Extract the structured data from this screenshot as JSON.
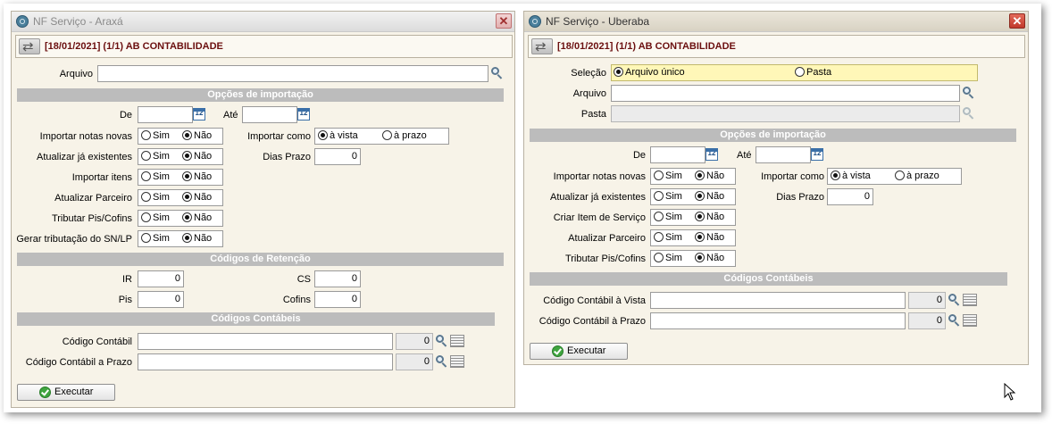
{
  "window_left": {
    "title": "NF Serviço - Araxá",
    "header": "[18/01/2021] (1/1) AB CONTABILIDADE",
    "arquivo_label": "Arquivo",
    "arquivo_value": "",
    "section_import": "Opções de importação",
    "de_label": "De",
    "ate_label": "Até",
    "cal_text": "12",
    "rows": [
      {
        "label": "Importar notas novas",
        "sim": "Sim",
        "nao": "Não",
        "selected": "nao"
      },
      {
        "label": "Atualizar já existentes",
        "sim": "Sim",
        "nao": "Não",
        "selected": "nao"
      },
      {
        "label": "Importar itens",
        "sim": "Sim",
        "nao": "Não",
        "selected": "nao"
      },
      {
        "label": "Atualizar Parceiro",
        "sim": "Sim",
        "nao": "Não",
        "selected": "nao"
      },
      {
        "label": "Tributar Pis/Cofins",
        "sim": "Sim",
        "nao": "Não",
        "selected": "nao"
      },
      {
        "label": "Gerar tributação do SN/LP",
        "sim": "Sim",
        "nao": "Não",
        "selected": "nao"
      }
    ],
    "importar_como_label": "Importar como",
    "a_vista": "à vista",
    "a_prazo": "à prazo",
    "dias_prazo_label": "Dias Prazo",
    "dias_prazo_value": "0",
    "section_retencao": "Códigos de Retenção",
    "ir_label": "IR",
    "ir_value": "0",
    "cs_label": "CS",
    "cs_value": "0",
    "pis_label": "Pis",
    "pis_value": "0",
    "cofins_label": "Cofins",
    "cofins_value": "0",
    "section_contabeis": "Códigos Contábeis",
    "codigo_contabil_label": "Código Contábil",
    "codigo_contabil_num": "0",
    "codigo_contabil_prazo_label": "Código Contábil a Prazo",
    "codigo_contabil_prazo_num": "0",
    "executar": "Executar"
  },
  "window_right": {
    "title": "NF Serviço - Uberaba",
    "header": "[18/01/2021] (1/1) AB CONTABILIDADE",
    "selecao_label": "Seleção",
    "arquivo_unico": "Arquivo único",
    "pasta_opt": "Pasta",
    "arquivo_label": "Arquivo",
    "pasta_label": "Pasta",
    "section_import": "Opções de importação",
    "de_label": "De",
    "ate_label": "Até",
    "cal_text": "12",
    "rows": [
      {
        "label": "Importar notas novas",
        "sim": "Sim",
        "nao": "Não",
        "selected": "nao"
      },
      {
        "label": "Atualizar já existentes",
        "sim": "Sim",
        "nao": "Não",
        "selected": "nao"
      },
      {
        "label": "Criar Item de Serviço",
        "sim": "Sim",
        "nao": "Não",
        "selected": "nao"
      },
      {
        "label": "Atualizar Parceiro",
        "sim": "Sim",
        "nao": "Não",
        "selected": "nao"
      },
      {
        "label": "Tributar Pis/Cofins",
        "sim": "Sim",
        "nao": "Não",
        "selected": "nao"
      }
    ],
    "importar_como_label": "Importar como",
    "a_vista": "à vista",
    "a_prazo": "à prazo",
    "dias_prazo_label": "Dias Prazo",
    "dias_prazo_value": "0",
    "section_contabeis": "Códigos Contábeis",
    "codigo_vista_label": "Código Contábil à Vista",
    "codigo_vista_num": "0",
    "codigo_prazo_label": "Código Contábil à Prazo",
    "codigo_prazo_num": "0",
    "executar": "Executar"
  }
}
